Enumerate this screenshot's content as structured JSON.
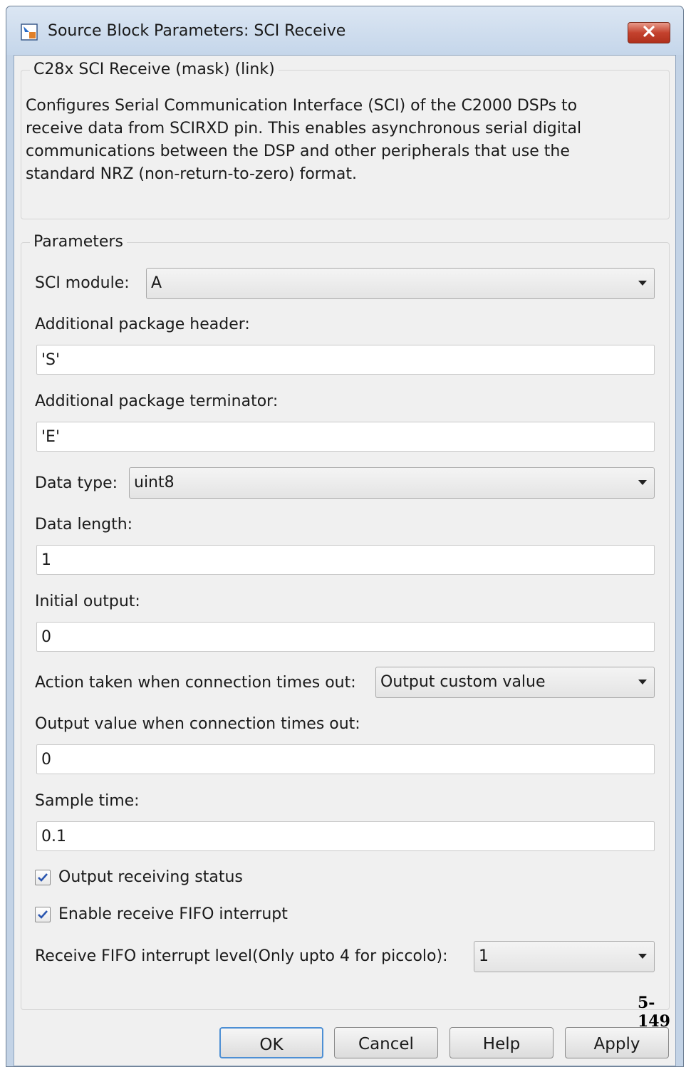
{
  "window": {
    "title": "Source Block Parameters: SCI Receive",
    "close_symbol": "✕"
  },
  "mask_group": {
    "label": "C28x SCI Receive (mask) (link)",
    "description": "Configures Serial Communication Interface (SCI) of the C2000 DSPs to receive data from SCIRXD pin. This enables asynchronous serial digital communications between the DSP and other peripherals that use the standard NRZ (non-return-to-zero) format."
  },
  "parameters": {
    "label": "Parameters",
    "sci_module": {
      "label": "SCI module:",
      "value": "A"
    },
    "package_header": {
      "label": "Additional package header:",
      "value": "'S'"
    },
    "package_terminator": {
      "label": "Additional package terminator:",
      "value": "'E'"
    },
    "data_type": {
      "label": "Data type:",
      "value": "uint8"
    },
    "data_length": {
      "label": "Data length:",
      "value": "1"
    },
    "initial_output": {
      "label": "Initial output:",
      "value": "0"
    },
    "timeout_action": {
      "label": "Action taken when connection times out:",
      "value": "Output custom value"
    },
    "timeout_value": {
      "label": "Output value when connection times out:",
      "value": "0"
    },
    "sample_time": {
      "label": "Sample time:",
      "value": "0.1"
    },
    "output_receiving_status": {
      "label": "Output receiving status",
      "checked": true
    },
    "enable_fifo_interrupt": {
      "label": "Enable receive FIFO interrupt",
      "checked": true
    },
    "fifo_interrupt_level": {
      "label": "Receive FIFO interrupt level(Only upto 4 for piccolo):",
      "value": "1"
    }
  },
  "buttons": {
    "ok": "OK",
    "cancel": "Cancel",
    "help": "Help",
    "apply": "Apply"
  },
  "page_number": "5-149",
  "icons": {
    "app": "simulink-block-icon",
    "close": "close-icon",
    "dropdown": "chevron-down-icon",
    "checkbox": "checkmark-icon"
  },
  "colors": {
    "titlebar": "#c5d6ea",
    "close_button": "#c4422e",
    "client_background": "#f0f0f0",
    "checkmark": "#2a56b0",
    "default_button_border": "#4d8fd4"
  }
}
